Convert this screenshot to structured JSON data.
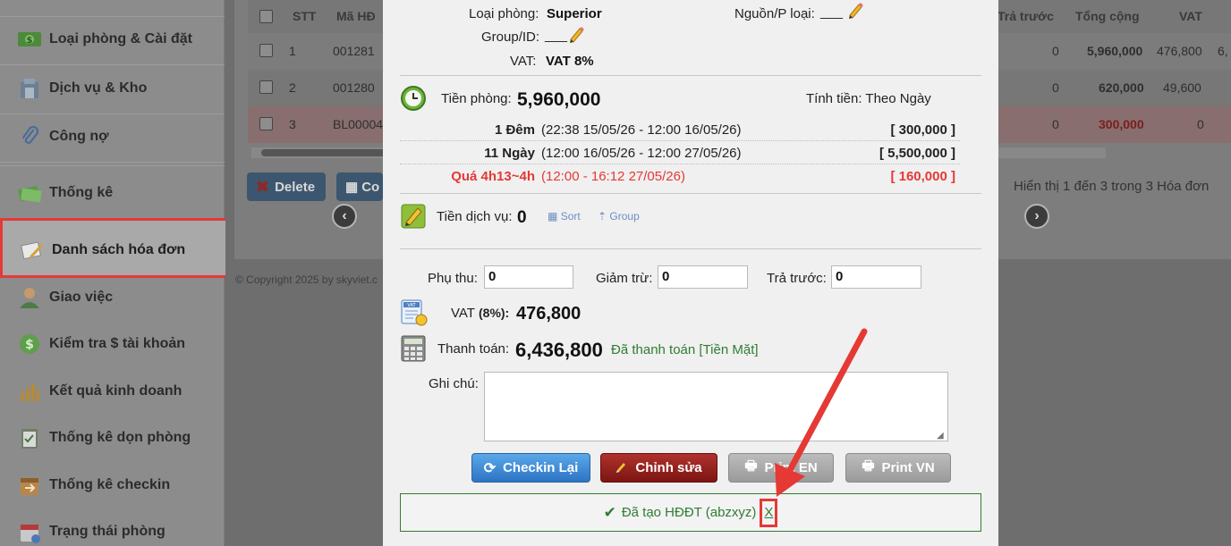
{
  "sidebar": {
    "items": [
      {
        "label": "Loại phòng & Cài đặt",
        "icon": "money-icon"
      },
      {
        "label": "Dịch vụ & Kho",
        "icon": "warehouse-icon"
      },
      {
        "label": "Công nợ",
        "icon": "paperclip-icon"
      },
      {
        "label": "Thống kê",
        "icon": "cash-icon"
      },
      {
        "label": "Danh sách hóa đơn",
        "icon": "invoice-icon"
      },
      {
        "label": "Giao việc",
        "icon": "user-icon"
      },
      {
        "label": "Kiểm tra $ tài khoản",
        "icon": "dollar-coin-icon"
      },
      {
        "label": "Kết quả kinh doanh",
        "icon": "bar-chart-icon"
      },
      {
        "label": "Thống kê dọn phòng",
        "icon": "clipboard-icon"
      },
      {
        "label": "Thống kê checkin",
        "icon": "checkin-icon"
      },
      {
        "label": "Trạng thái phòng",
        "icon": "calendar-icon"
      }
    ]
  },
  "table": {
    "headers": [
      "STT",
      "Mã HĐ",
      "Trả trước",
      "Tổng cộng",
      "VAT"
    ],
    "rows": [
      {
        "stt": "1",
        "code": "001281",
        "prepaid": "0",
        "total": "5,960,000",
        "vat": "476,800",
        "extra": "6,"
      },
      {
        "stt": "2",
        "code": "001280",
        "prepaid": "0",
        "total": "620,000",
        "vat": "49,600",
        "extra": ""
      },
      {
        "stt": "3",
        "code": "BL00004",
        "prepaid": "0",
        "total": "300,000",
        "vat": "0",
        "extra": ""
      }
    ],
    "buttons": {
      "delete": "Delete",
      "copy": "Co"
    },
    "showing": "Hiển thị 1 đến 3 trong 3 Hóa đơn",
    "copyright": "© Copyright 2025 by skyviet.c"
  },
  "modal": {
    "room_type_label": "Loại phòng:",
    "room_type_value": "Superior",
    "source_label": "Nguồn/P loại:",
    "source_value": "___",
    "group_label": "Group/ID:",
    "group_value": "___",
    "vat_label": "VAT:",
    "vat_value": "VAT 8%",
    "room_charge_label": "Tiền phòng:",
    "room_charge_value": "5,960,000",
    "billing_label": "Tính tiền: Theo Ngày",
    "lines": [
      {
        "label": "1 Đêm",
        "range": "(22:38 15/05/26 - 12:00 16/05/26)",
        "amount": "[ 300,000 ]",
        "color": "#222222"
      },
      {
        "label": "11 Ngày",
        "range": "(12:00 16/05/26 - 12:00 27/05/26)",
        "amount": "[ 5,500,000 ]",
        "color": "#222222"
      },
      {
        "label": "Quá 4h13~4h",
        "range": "(12:00 - 16:12 27/05/26)",
        "amount": "[ 160,000 ]",
        "color": "#e53935"
      }
    ],
    "service_label": "Tiền dịch vụ:",
    "service_value": "0",
    "sort_label": "Sort",
    "group_btn_label": "Group",
    "surcharge_label": "Phụ thu:",
    "surcharge_value": "0",
    "discount_label": "Giảm trừ:",
    "discount_value": "0",
    "prepaid_label": "Trả trước:",
    "prepaid_value": "0",
    "vat_line_label": "VAT",
    "vat_rate": "(8%):",
    "vat_amount": "476,800",
    "payment_label": "Thanh toán:",
    "payment_value": "6,436,800",
    "payment_status": "Đã thanh toán [Tiền Mặt]",
    "note_label": "Ghi chú:",
    "note_value": "",
    "buttons": {
      "checkin": "Checkin Lại",
      "edit": "Chỉnh sửa",
      "print_en": "Print EN",
      "print_vn": "Print VN"
    },
    "notice_text": "Đã tạo HĐĐT (abzxyz)",
    "notice_x": "X"
  },
  "colors": {
    "accent_red": "#e53935",
    "success_green": "#2e7d32",
    "primary_blue": "#2d74c4"
  }
}
